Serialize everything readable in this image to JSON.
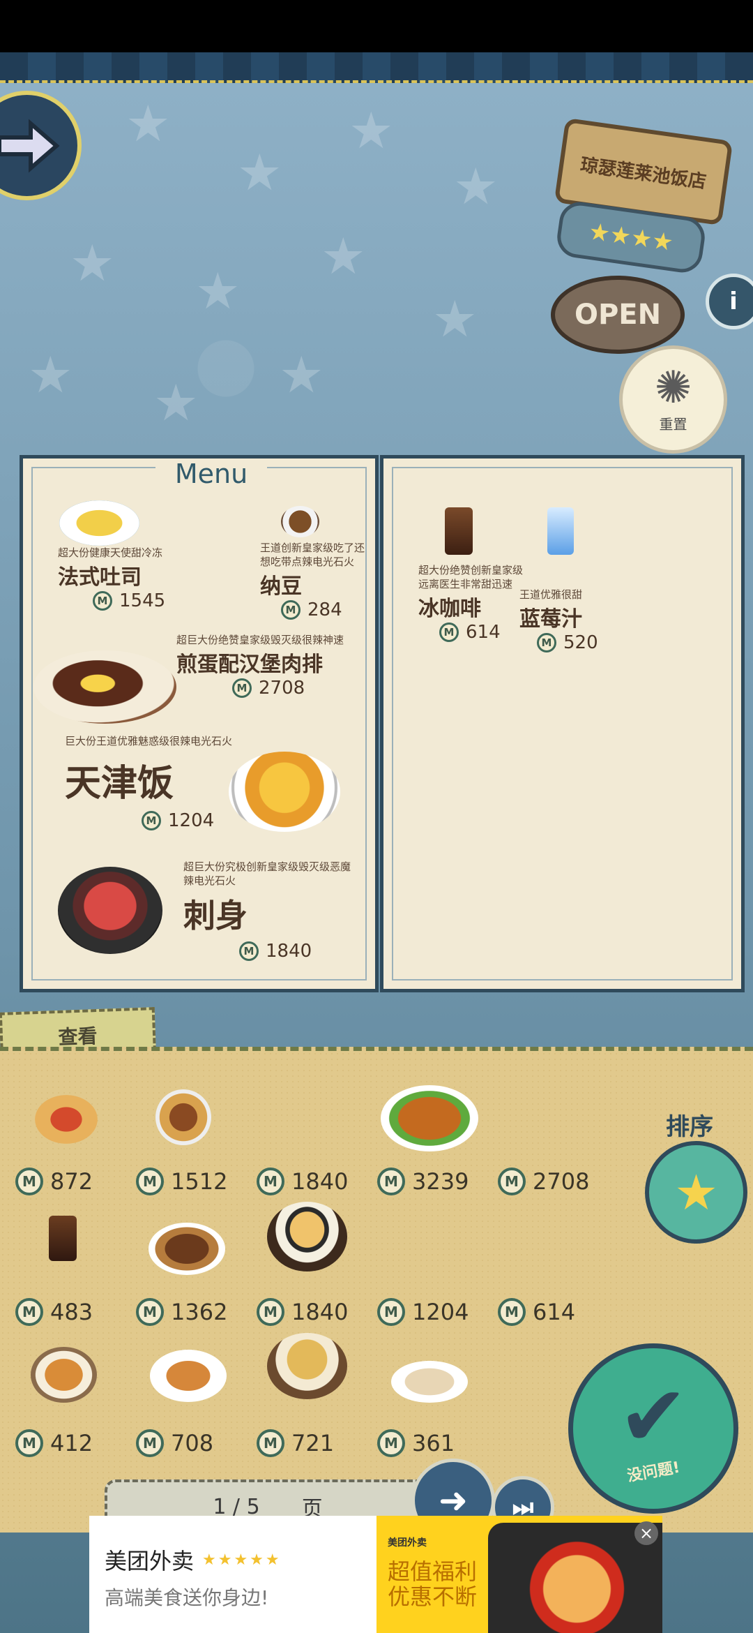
{
  "restaurant_sign": {
    "name": "琼瑟莲莱池饭店",
    "status": "OPEN",
    "stars": "★★★★"
  },
  "buttons": {
    "reset_label": "重置",
    "view_tab_label": "查看",
    "sort_label": "排序",
    "confirm_label": "没问题!"
  },
  "menu": {
    "title": "Menu",
    "left_items": [
      {
        "desc": "超大份健康天使甜冷冻",
        "name": "法式吐司",
        "price": "1545"
      },
      {
        "desc": "王道创新皇家级吃了还想吃带点辣电光石火",
        "name": "纳豆",
        "price": "284"
      },
      {
        "desc": "超巨大份绝赞皇家级毁灭级很辣神速",
        "name": "煎蛋配汉堡肉排",
        "price": "2708"
      },
      {
        "desc": "巨大份王道优雅魅惑级很辣电光石火",
        "name": "天津饭",
        "price": "1204"
      },
      {
        "desc": "超巨大份究极创新皇家级毁灭级恶魔辣电光石火",
        "name": "刺身",
        "price": "1840"
      }
    ],
    "right_items": [
      {
        "desc": "超大份绝赞创新皇家级远离医生非常甜迅速",
        "name": "冰咖啡",
        "price": "614"
      },
      {
        "desc": "王道优雅很甜",
        "name": "蓝莓汁",
        "price": "520"
      }
    ]
  },
  "tray_items": [
    {
      "price": "872",
      "icon": "hotdog-icon"
    },
    {
      "price": "1512",
      "icon": "burger-icon"
    },
    {
      "price": "1840",
      "icon": "sashimi-icon"
    },
    {
      "price": "3239",
      "icon": "roast-chicken-icon"
    },
    {
      "price": "2708",
      "icon": "hamburg-steak-icon"
    },
    {
      "price": "483",
      "icon": "coffee-cup-icon"
    },
    {
      "price": "1362",
      "icon": "noodles-plate-icon"
    },
    {
      "price": "1840",
      "icon": "ramen-bowl-icon"
    },
    {
      "price": "1204",
      "icon": "omelette-rice-icon"
    },
    {
      "price": "614",
      "icon": "iced-coffee-icon"
    },
    {
      "price": "412",
      "icon": "stew-bowl-icon"
    },
    {
      "price": "708",
      "icon": "croquette-plate-icon"
    },
    {
      "price": "721",
      "icon": "soup-bowl-icon"
    },
    {
      "price": "361",
      "icon": "dumplings-plate-icon"
    }
  ],
  "pager": {
    "page": "1 / 5",
    "unit": "页"
  },
  "ad": {
    "title": "美团外卖",
    "stars": "★★★★★",
    "subtitle": "高端美食送你身边!",
    "brand": "美团外卖",
    "promo_line1": "超值福利",
    "promo_line2": "优惠不断"
  }
}
